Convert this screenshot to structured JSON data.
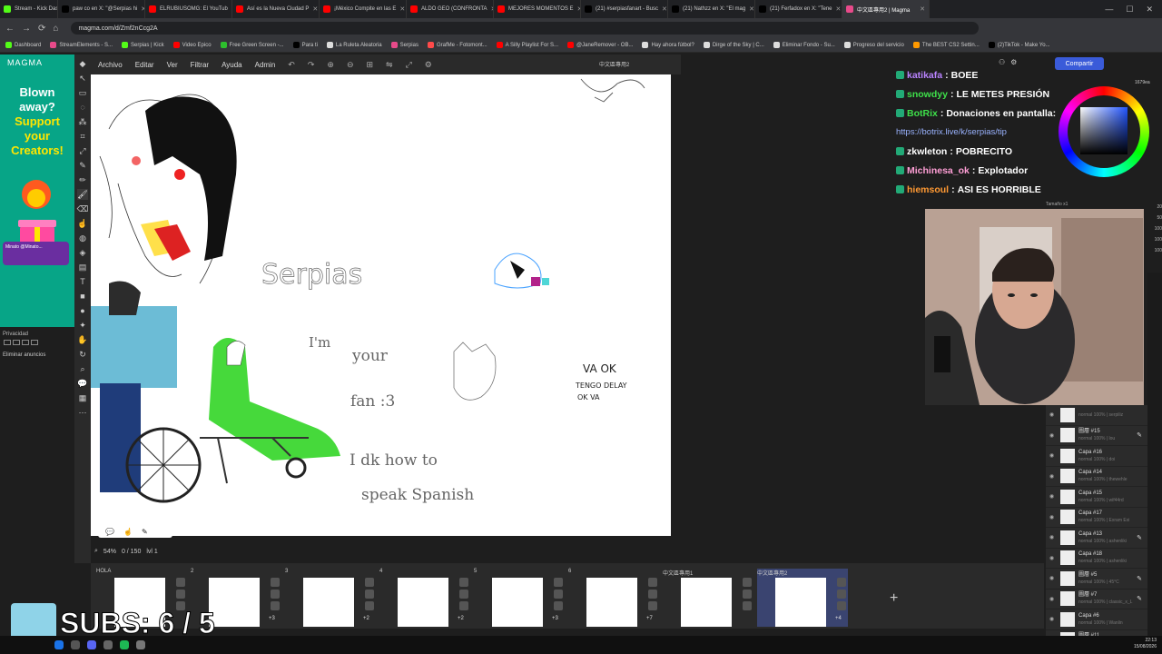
{
  "browser": {
    "tabs": [
      {
        "title": "Stream - Kick Dashboard",
        "color": "#53fc18"
      },
      {
        "title": "paw co en X: \"@Serpias hi",
        "color": "#000000"
      },
      {
        "title": "ELRUBIUSOMG: El YouTub",
        "color": "#ff0000"
      },
      {
        "title": "Así es la Nueva Ciudad P",
        "color": "#ff0000"
      },
      {
        "title": "¡México Compite en las E",
        "color": "#ff0000"
      },
      {
        "title": "ALDO GEO (CONFRONTA",
        "color": "#ff0000"
      },
      {
        "title": "MEJORES MOMENTOS E",
        "color": "#ff0000"
      },
      {
        "title": "(21) #serpiasfanart - Busc",
        "color": "#000000"
      },
      {
        "title": "(21) Nathzz en X: \"El mag",
        "color": "#000000"
      },
      {
        "title": "(21) Ferfadox en X: \"Tene",
        "color": "#000000"
      },
      {
        "title": "中文區專用2 | Magma",
        "color": "#e84a8a",
        "active": true
      }
    ],
    "url": "magma.com/d/Zmf2nCcg2A",
    "bookmarks": [
      "Dashboard",
      "StreamElements - S...",
      "Serpias | Kick",
      "Video Epico",
      "Free Green Screen -...",
      "Para ti",
      "La Ruleta Aleatoria",
      "Serpias",
      "GrafMe - Fotomont...",
      "A Silly Playlist For S...",
      "@JaneRemover - OB...",
      "Hay ahora fútbol?",
      "Dirge of the Sky | C...",
      "Eliminar Fondo - Su...",
      "Progreso del servicio",
      "The BEST CS2 Settin...",
      "(2)TikTok - Make Yo..."
    ]
  },
  "ad": {
    "logo": "MAGMA",
    "line1": "Blown",
    "line2": "away?",
    "line3": "Support",
    "line4": "your",
    "line5": "Creators!",
    "privacy": "Privacidad",
    "remove_ads": "Eliminar anuncios"
  },
  "menu": {
    "items": [
      "Archivo",
      "Editar",
      "Ver",
      "Filtrar",
      "Ayuda",
      "Admin"
    ],
    "filename": "中文區專用2",
    "share": "Compartir"
  },
  "canvas": {
    "text_serpias": "Serpias",
    "text_im": "I'm",
    "text_your": "your",
    "text_fan": "fan :3",
    "text_idk": "I dk how to",
    "text_speak": "speak Spanish",
    "text_va": "VA OK",
    "text_tengo": "TENGO DELAY",
    "text_okva": "OK VA"
  },
  "status": {
    "zoom": "54%",
    "counter": "0 / 150",
    "level": "lvl 1"
  },
  "filmstrip": {
    "frames": [
      {
        "label": "HOLA",
        "count": ""
      },
      {
        "label": "2",
        "count": "+3"
      },
      {
        "label": "3",
        "count": "+2"
      },
      {
        "label": "4",
        "count": "+2"
      },
      {
        "label": "5",
        "count": "+3"
      },
      {
        "label": "6",
        "count": "+7"
      },
      {
        "label": "中文區專用1",
        "count": ""
      },
      {
        "label": "中文區專用2",
        "count": "+4",
        "selected": true
      }
    ],
    "add": "+"
  },
  "overlay": {
    "subs": "SUBS: 6 / 5"
  },
  "chat": [
    {
      "user": "katikafa",
      "color": "#b983ff",
      "text": "BOEE"
    },
    {
      "user": "snowdyy",
      "color": "#3ee04a",
      "text": "LE METES PRESIÓN"
    },
    {
      "user": "BotRix",
      "color": "#3ee04a",
      "text": "Donaciones en pantalla:"
    },
    {
      "user": "",
      "color": "#9ab3ff",
      "text": "https://botrix.live/k/serpias/tip",
      "link": true
    },
    {
      "user": "zkwleton",
      "color": "#ffffff",
      "text": "POBRECITO"
    },
    {
      "user": "Michinesa_ok",
      "color": "#ff9fd6",
      "text": "Explotador"
    },
    {
      "user": "hiemsoul",
      "color": "#ff9933",
      "text": "ASI ES HORRIBLE"
    }
  ],
  "color_panel": {
    "hex": "1679ea",
    "size_label": "Tamaño x1"
  },
  "right_numbers": [
    "20",
    "50",
    "100",
    "100",
    "100"
  ],
  "layers": [
    {
      "name": "",
      "mode": "normal 100% | serpiliz"
    },
    {
      "name": "圖層 #15",
      "mode": "normal 100% | lou",
      "pen": true
    },
    {
      "name": "Capa #16",
      "mode": "normal 100% | doi"
    },
    {
      "name": "Capa #14",
      "mode": "normal 100% | thewehle"
    },
    {
      "name": "Capa #15",
      "mode": "normal 100% | wif44rd"
    },
    {
      "name": "Capa #17",
      "mode": "normal 100% | Exram Exi"
    },
    {
      "name": "Capa #13",
      "mode": "normal 100% | ashenliki",
      "pen": true
    },
    {
      "name": "Capa #18",
      "mode": "normal 100% | ashenliki"
    },
    {
      "name": "圖層 #5",
      "mode": "normal 100% | 45°C",
      "pen": true
    },
    {
      "name": "圖層 #7",
      "mode": "normal 100% | classic_x_L",
      "pen": true
    },
    {
      "name": "Capa #6",
      "mode": "normal 100% | Wanlin"
    },
    {
      "name": "圖層 #11",
      "mode": "normal 100% |"
    }
  ],
  "clock": {
    "time": "22:13",
    "date": "15/08/2026"
  }
}
